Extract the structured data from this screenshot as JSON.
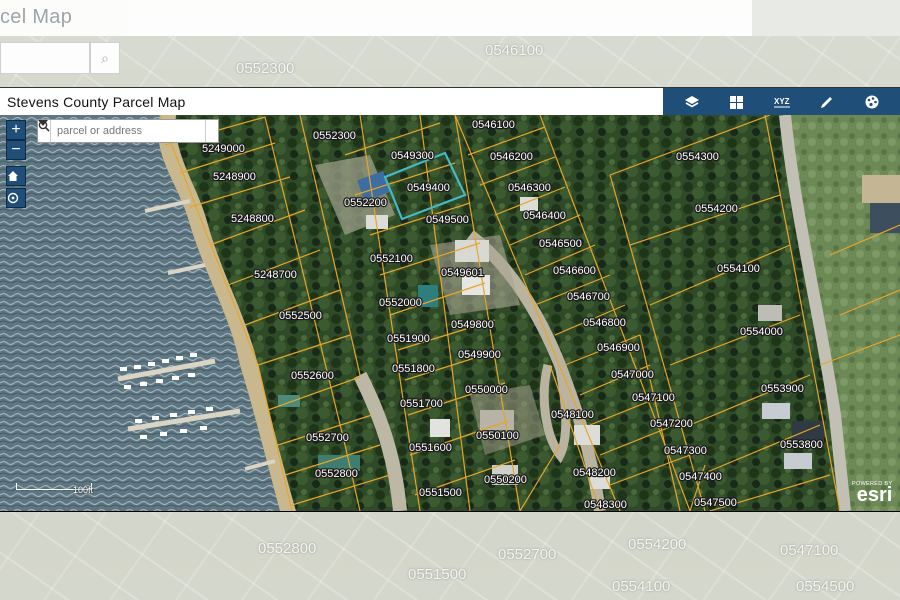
{
  "background": {
    "title_fragment": "cel Map",
    "labels": [
      "0546100",
      "0552300",
      "0552800",
      "0552700",
      "0551500",
      "0554200",
      "0547100",
      "0554100",
      "0554500"
    ]
  },
  "app": {
    "title": "Stevens County Parcel Map",
    "toolbar_icons": [
      "layers-icon",
      "basemap-grid-icon",
      "xyz-coordinates-icon",
      "measure-pencil-icon",
      "share-palette-icon"
    ]
  },
  "colors": {
    "header_bar": "#1f4e79",
    "parcel_line": "#e6a52a",
    "selected_parcel": "#45b8c9"
  },
  "map": {
    "search_placeholder": "parcel or address",
    "zoom_in": "+",
    "zoom_out": "−",
    "scale_label": "100ft",
    "attribution_small": "POWERED BY",
    "attribution_brand": "esri",
    "selected_parcel": "0549400",
    "parcels": [
      "5249000",
      "5248900",
      "5248800",
      "5248700",
      "0552300",
      "0549300",
      "0549400",
      "0552200",
      "0549500",
      "0552100",
      "0549601",
      "0552000",
      "0552500",
      "0549800",
      "0551900",
      "0549900",
      "0551800",
      "0552600",
      "0550000",
      "0551700",
      "0552700",
      "0551600",
      "0550100",
      "0552800",
      "0550200",
      "0551500",
      "0546100",
      "0546200",
      "0546300",
      "0546400",
      "0546500",
      "0546600",
      "0546700",
      "0546800",
      "0546900",
      "0547000",
      "0548100",
      "0547100",
      "0547200",
      "0548200",
      "0547300",
      "0547400",
      "0548300",
      "0547500",
      "0554300",
      "0554200",
      "0554100",
      "0554000",
      "0553900",
      "0553800"
    ]
  }
}
